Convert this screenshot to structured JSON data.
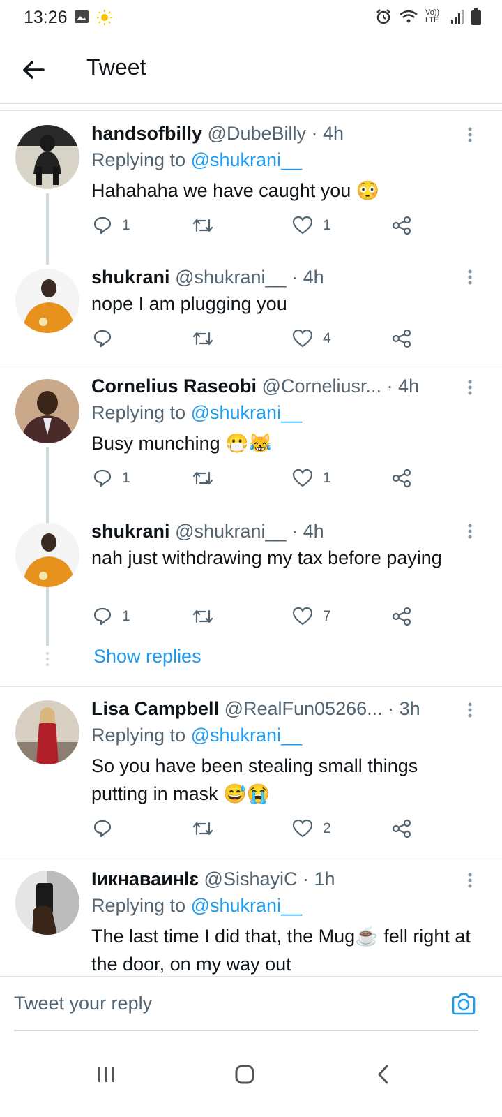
{
  "status": {
    "time": "13:26",
    "left_icons": [
      "image-icon",
      "sun-icon"
    ],
    "right_icons": [
      "alarm-icon",
      "wifi-icon",
      "volte-icon",
      "signal-icon",
      "battery-icon"
    ],
    "volte_label": "Vo)) LTE"
  },
  "header": {
    "title": "Tweet",
    "back_icon": "arrow-left-icon"
  },
  "tweets": [
    {
      "name": "handsofbilly",
      "handle": "@DubeBilly",
      "time": "· 4h",
      "replying_prefix": "Replying to",
      "replying_to": "@shukrani__",
      "text": "Hahahaha we have caught you 😳",
      "replies": "1",
      "retweets": "",
      "likes": "1"
    },
    {
      "name": "shukrani",
      "handle": "@shukrani__",
      "time": "· 4h",
      "text": "nope I am plugging you",
      "replies": "",
      "retweets": "",
      "likes": "4"
    },
    {
      "name": "Cornelius Raseobi",
      "handle": "@Corneliusr...",
      "time": "· 4h",
      "replying_prefix": "Replying to",
      "replying_to": "@shukrani__",
      "text": "Busy munching 😷😹",
      "replies": "1",
      "retweets": "",
      "likes": "1"
    },
    {
      "name": "shukrani",
      "handle": "@shukrani__",
      "time": "· 4h",
      "text": "nah just withdrawing my tax before paying",
      "replies": "1",
      "retweets": "",
      "likes": "7"
    },
    {
      "name": "Lisa Campbell",
      "handle": "@RealFun05266...",
      "time": "· 3h",
      "replying_prefix": "Replying to",
      "replying_to": "@shukrani__",
      "text": "So you have been stealing small things putting in mask 😅😭",
      "replies": "",
      "retweets": "",
      "likes": "2"
    },
    {
      "name": "Іикнаваинlɛ",
      "handle": "@SishayiC",
      "time": "· 1h",
      "replying_prefix": "Replying to",
      "replying_to": "@shukrani__",
      "text": "The last time I did that, the Mug☕ fell right at the door, on my way out",
      "replies": "",
      "retweets": "",
      "likes": ""
    }
  ],
  "show_replies": "Show replies",
  "reply_box": {
    "placeholder": "Tweet your reply"
  },
  "colors": {
    "accent": "#1d9bf0",
    "muted": "#536471",
    "text": "#0f1419",
    "divider": "#e1e4e8"
  },
  "nav": [
    "recent-apps-icon",
    "home-icon",
    "back-icon"
  ]
}
